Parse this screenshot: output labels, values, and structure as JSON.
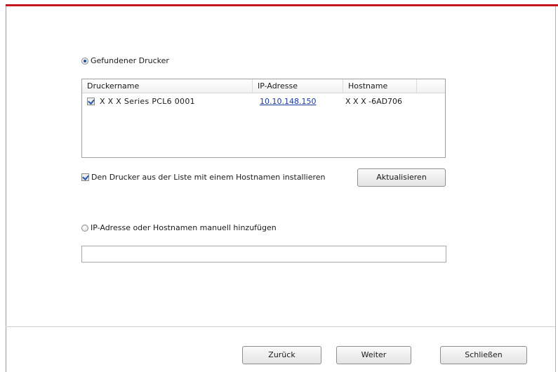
{
  "found_printer": {
    "label": "Gefundener Drucker",
    "selected": true
  },
  "printer_list": {
    "columns": [
      "Druckername",
      "IP-Adresse",
      "Hostname"
    ],
    "rows": [
      {
        "checked": true,
        "name": "X X X  Series PCL6 0001",
        "ip": "10.10.148.150",
        "hostname": "X X X -6AD706"
      }
    ]
  },
  "install_with_hostname": {
    "label": "Den Drucker aus der Liste mit einem Hostnamen installieren",
    "checked": true
  },
  "refresh_button": {
    "label": "Aktualisieren"
  },
  "manual_add": {
    "label": "IP-Adresse oder Hostnamen manuell hinzufügen",
    "selected": false,
    "input_value": ""
  },
  "footer": {
    "back_label": "Zurück",
    "next_label": "Weiter",
    "close_label": "Schließen"
  },
  "colors": {
    "accent_bar": "#c4161c",
    "link": "#1a3aa0"
  }
}
